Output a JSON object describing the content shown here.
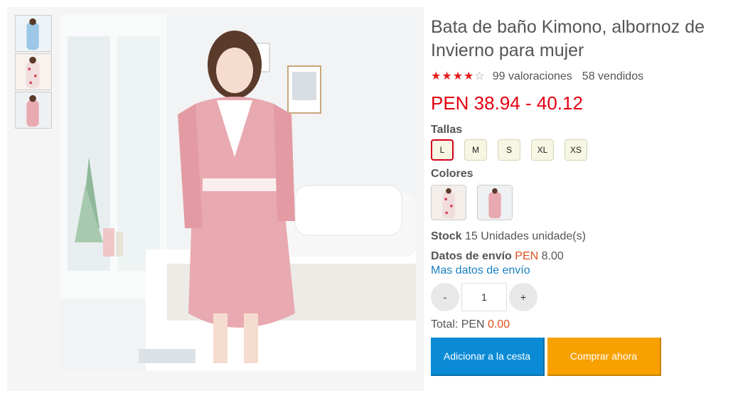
{
  "product": {
    "title": "Bata de baño Kimono, albornoz de Invierno para mujer",
    "rating_stars": 4,
    "rating_max": 5,
    "reviews": "99 valoraciones",
    "sold": "58 vendidos",
    "price": "PEN 38.94 - 40.12"
  },
  "sizes": {
    "label": "Tallas",
    "options": [
      "L",
      "M",
      "S",
      "XL",
      "XS"
    ],
    "selected": "L"
  },
  "colors": {
    "label": "Colores"
  },
  "stock": {
    "label": "Stock",
    "value": "15 Unidades unidade(s)"
  },
  "shipping": {
    "label": "Datos de envío",
    "currency": "PEN",
    "amount": "8.00",
    "more_link": "Mas datos de envío"
  },
  "quantity": {
    "minus": "-",
    "value": "1",
    "plus": "+"
  },
  "total": {
    "label": "Total: PEN",
    "value": "0.00"
  },
  "buttons": {
    "add_to_cart": "Adicionar a la cesta",
    "buy_now": "Comprar ahora"
  },
  "theme": {
    "price_color": "#e4000f",
    "accent_blue": "#0b8bd5",
    "accent_orange": "#f7a000",
    "selected_border": "#d6001c"
  }
}
